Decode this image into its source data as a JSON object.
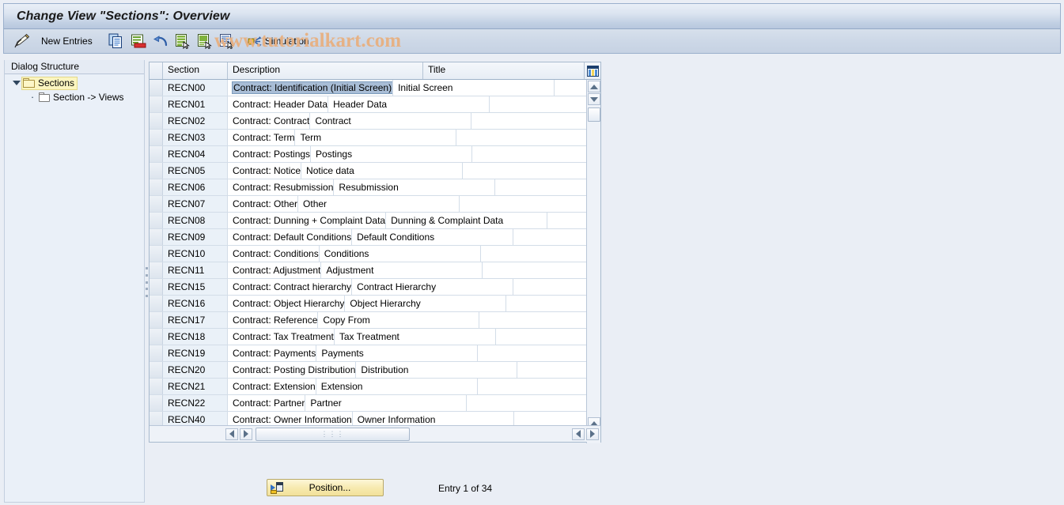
{
  "window": {
    "title": "Change View \"Sections\": Overview"
  },
  "watermark": {
    "text": "www.tutorialkart.com",
    "color": "#e8b080"
  },
  "toolbar": {
    "change_icon": "pencil-change-icon",
    "new_entries_label": "New Entries",
    "buttons": [
      {
        "icon": "copy-icon",
        "name": "copy-as-button"
      },
      {
        "icon": "delete-icon",
        "name": "delete-button"
      },
      {
        "icon": "undo-icon",
        "name": "undo-change-button"
      },
      {
        "icon": "select-all-icon",
        "name": "select-all-button"
      },
      {
        "icon": "deselect-all-icon",
        "name": "deselect-all-button"
      },
      {
        "icon": "select-block-icon",
        "name": "select-block-button"
      }
    ],
    "simulation_label": "Simulation",
    "simulation_icon": "simulation-arrows-icon"
  },
  "sidebar": {
    "header": "Dialog Structure",
    "items": [
      {
        "label": "Sections",
        "level": 1,
        "selected": true,
        "icon": "folder-open-icon",
        "twisty": "expanded"
      },
      {
        "label": "Section -> Views",
        "level": 2,
        "selected": false,
        "icon": "folder-closed-icon",
        "twisty": "leaf"
      }
    ]
  },
  "table": {
    "columns": [
      {
        "key": "section",
        "label": "Section"
      },
      {
        "key": "description",
        "label": "Description"
      },
      {
        "key": "title",
        "label": "Title"
      }
    ],
    "config_icon": "table-settings-icon",
    "selected_cell": {
      "row": 0,
      "column": "description"
    },
    "rows": [
      {
        "section": "RECN00",
        "description": "Contract: Identification (Initial Screen)",
        "title": "Initial Screen"
      },
      {
        "section": "RECN01",
        "description": "Contract: Header Data",
        "title": "Header Data"
      },
      {
        "section": "RECN02",
        "description": "Contract: Contract",
        "title": "Contract"
      },
      {
        "section": "RECN03",
        "description": "Contract: Term",
        "title": "Term"
      },
      {
        "section": "RECN04",
        "description": "Contract: Postings",
        "title": "Postings"
      },
      {
        "section": "RECN05",
        "description": "Contract: Notice",
        "title": "Notice data"
      },
      {
        "section": "RECN06",
        "description": "Contract: Resubmission",
        "title": "Resubmission"
      },
      {
        "section": "RECN07",
        "description": "Contract: Other",
        "title": "Other"
      },
      {
        "section": "RECN08",
        "description": "Contract: Dunning + Complaint Data",
        "title": "Dunning & Complaint Data"
      },
      {
        "section": "RECN09",
        "description": "Contract: Default Conditions",
        "title": "Default Conditions"
      },
      {
        "section": "RECN10",
        "description": "Contract: Conditions",
        "title": "Conditions"
      },
      {
        "section": "RECN11",
        "description": "Contract: Adjustment",
        "title": "Adjustment"
      },
      {
        "section": "RECN15",
        "description": "Contract: Contract hierarchy",
        "title": "Contract Hierarchy"
      },
      {
        "section": "RECN16",
        "description": "Contract: Object Hierarchy",
        "title": "Object Hierarchy"
      },
      {
        "section": "RECN17",
        "description": "Contract: Reference",
        "title": "Copy From"
      },
      {
        "section": "RECN18",
        "description": "Contract: Tax Treatment",
        "title": "Tax Treatment"
      },
      {
        "section": "RECN19",
        "description": "Contract: Payments",
        "title": "Payments"
      },
      {
        "section": "RECN20",
        "description": "Contract: Posting Distribution",
        "title": "Distribution"
      },
      {
        "section": "RECN21",
        "description": "Contract: Extension",
        "title": "Extension"
      },
      {
        "section": "RECN22",
        "description": "Contract: Partner",
        "title": "Partner"
      },
      {
        "section": "RECN40",
        "description": "Contract: Owner Information",
        "title": "Owner Information"
      }
    ]
  },
  "footer": {
    "position_label": "Position...",
    "position_icon": "position-goto-icon",
    "entry_info": "Entry 1 of 34"
  }
}
